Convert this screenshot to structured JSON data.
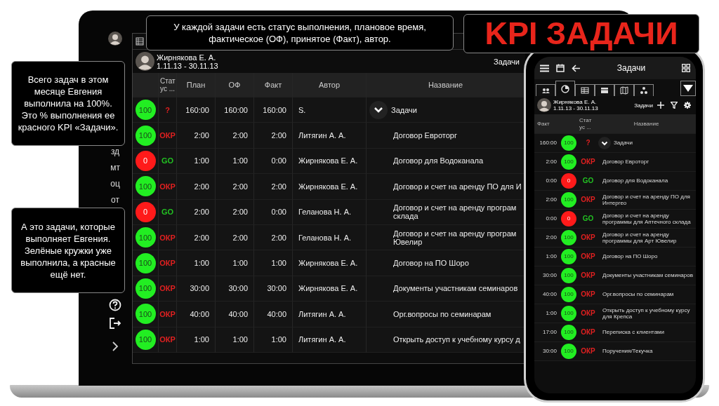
{
  "title": "KPI ЗАДАЧИ",
  "callouts": [
    {
      "text": "У каждой задачи есть статус выполнения, плановое время, фактическое (ОФ), принятое (Факт), автор."
    },
    {
      "text": "Всего задач в этом месяце Евгения выполнила на 100%. Это % выполнения ее красного KPI «Задачи»."
    },
    {
      "text": "А это задачи, которые выполняет Евгения. Зелёные кружки уже выполнила, а красные ещё нет."
    }
  ],
  "laptop": {
    "sidebar_items": [
      "зд",
      "мт",
      "оц",
      "от"
    ],
    "user": {
      "name": "Жирнякова Е. А.",
      "period": "1.11.13 - 30.11.13"
    },
    "section": "Задачи",
    "columns": [
      "Стат ус ...",
      "План",
      "ОФ",
      "Факт",
      "Автор",
      "Название"
    ],
    "rows": [
      {
        "kind": "group",
        "done": true,
        "percent": "100",
        "status": {
          "text": "?",
          "color": "#e02020"
        },
        "plan": "160:00",
        "of": "160:00",
        "fact": "160:00",
        "author": "S.",
        "name": "Задачи"
      },
      {
        "kind": "task",
        "done": true,
        "percent": "100",
        "status": {
          "text": "ОКР",
          "color": "#e02020"
        },
        "plan": "2:00",
        "of": "2:00",
        "fact": "2:00",
        "author": "Литягин А. А.",
        "name": "Договор Евроторг"
      },
      {
        "kind": "task",
        "done": false,
        "percent": "0",
        "status": {
          "text": "GO",
          "color": "#22c022"
        },
        "plan": "1:00",
        "of": "1:00",
        "fact": "0:00",
        "author": "Жирнякова Е. А.",
        "name": "Договор для Водоканала"
      },
      {
        "kind": "task",
        "done": true,
        "percent": "100",
        "status": {
          "text": "ОКР",
          "color": "#e02020"
        },
        "plan": "2:00",
        "of": "2:00",
        "fact": "2:00",
        "author": "Жирнякова Е. А.",
        "name": "Договор и счет на аренду ПО для И"
      },
      {
        "kind": "task",
        "done": false,
        "percent": "0",
        "status": {
          "text": "GO",
          "color": "#22c022"
        },
        "plan": "2:00",
        "of": "2:00",
        "fact": "0:00",
        "author": "Геланова Н. А.",
        "name": "Договор и счет на аренду програм\nсклада"
      },
      {
        "kind": "task",
        "done": true,
        "percent": "100",
        "status": {
          "text": "ОКР",
          "color": "#e02020"
        },
        "plan": "2:00",
        "of": "2:00",
        "fact": "2:00",
        "author": "Геланова Н. А.",
        "name": "Договор и счет на аренду програм\nЮвелир"
      },
      {
        "kind": "task",
        "done": true,
        "percent": "100",
        "status": {
          "text": "ОКР",
          "color": "#e02020"
        },
        "plan": "1:00",
        "of": "1:00",
        "fact": "1:00",
        "author": "Жирнякова Е. А.",
        "name": "Договор на ПО Шоро"
      },
      {
        "kind": "task",
        "done": true,
        "percent": "100",
        "status": {
          "text": "ОКР",
          "color": "#e02020"
        },
        "plan": "30:00",
        "of": "30:00",
        "fact": "30:00",
        "author": "Жирнякова Е. А.",
        "name": "Документы участникам семинаров"
      },
      {
        "kind": "task",
        "done": true,
        "percent": "100",
        "status": {
          "text": "ОКР",
          "color": "#e02020"
        },
        "plan": "40:00",
        "of": "40:00",
        "fact": "40:00",
        "author": "Литягин А. А.",
        "name": "Орг.вопросы по семинарам"
      },
      {
        "kind": "task",
        "done": true,
        "percent": "100",
        "status": {
          "text": "ОКР",
          "color": "#e02020"
        },
        "plan": "1:00",
        "of": "1:00",
        "fact": "1:00",
        "author": "Литягин А. А.",
        "name": "Открыть доступ к учебному курсу д"
      }
    ]
  },
  "phone": {
    "title": "Задачи",
    "tabs": [
      {
        "selected": false
      },
      {
        "selected": true
      },
      {
        "selected": false
      },
      {
        "selected": false
      },
      {
        "selected": false
      },
      {
        "selected": false
      }
    ],
    "user": {
      "name": "Жирнякова Е. А.",
      "period": "1.11.13 - 30.11.13"
    },
    "section": "Задачи",
    "columns": [
      "Факт",
      "Стат ус ...",
      "Название"
    ],
    "rows": [
      {
        "kind": "group",
        "fact": "160:00",
        "done": true,
        "percent": "100",
        "status": {
          "text": "?",
          "color": "#e02020"
        },
        "name": "Задачи"
      },
      {
        "kind": "task",
        "fact": "2:00",
        "done": true,
        "percent": "100",
        "status": {
          "text": "ОКР",
          "color": "#e02020"
        },
        "name": "Договор Евроторг"
      },
      {
        "kind": "task",
        "fact": "0:00",
        "done": false,
        "percent": "0",
        "status": {
          "text": "GO",
          "color": "#22c022"
        },
        "name": "Договор для Водоканала"
      },
      {
        "kind": "task",
        "fact": "2:00",
        "done": true,
        "percent": "100",
        "status": {
          "text": "ОКР",
          "color": "#e02020"
        },
        "name": "Договор и счет на аренду ПО для Интергео"
      },
      {
        "kind": "task",
        "fact": "0:00",
        "done": false,
        "percent": "0",
        "status": {
          "text": "GO",
          "color": "#22c022"
        },
        "name": "Договор и счет на аренду программы для Аптечного склада"
      },
      {
        "kind": "task",
        "fact": "2:00",
        "done": true,
        "percent": "100",
        "status": {
          "text": "ОКР",
          "color": "#e02020"
        },
        "name": "Договор и счет на аренду программы для Арт Ювелир"
      },
      {
        "kind": "task",
        "fact": "1:00",
        "done": true,
        "percent": "100",
        "status": {
          "text": "ОКР",
          "color": "#e02020"
        },
        "name": "Договор на ПО Шоро"
      },
      {
        "kind": "task",
        "fact": "30:00",
        "done": true,
        "percent": "100",
        "status": {
          "text": "ОКР",
          "color": "#e02020"
        },
        "name": "Документы участникам семинаров"
      },
      {
        "kind": "task",
        "fact": "40:00",
        "done": true,
        "percent": "100",
        "status": {
          "text": "ОКР",
          "color": "#e02020"
        },
        "name": "Орг.вопросы по семинарам"
      },
      {
        "kind": "task",
        "fact": "1:00",
        "done": true,
        "percent": "100",
        "status": {
          "text": "ОКР",
          "color": "#e02020"
        },
        "name": "Открыть доступ к учебному курсу для Крепса"
      },
      {
        "kind": "task",
        "fact": "17:00",
        "done": true,
        "percent": "100",
        "status": {
          "text": "ОКР",
          "color": "#e02020"
        },
        "name": "Переписка с клиентами"
      },
      {
        "kind": "task",
        "fact": "30:00",
        "done": true,
        "percent": "100",
        "status": {
          "text": "ОКР",
          "color": "#e02020"
        },
        "name": "Поручения/Текучка"
      }
    ]
  }
}
